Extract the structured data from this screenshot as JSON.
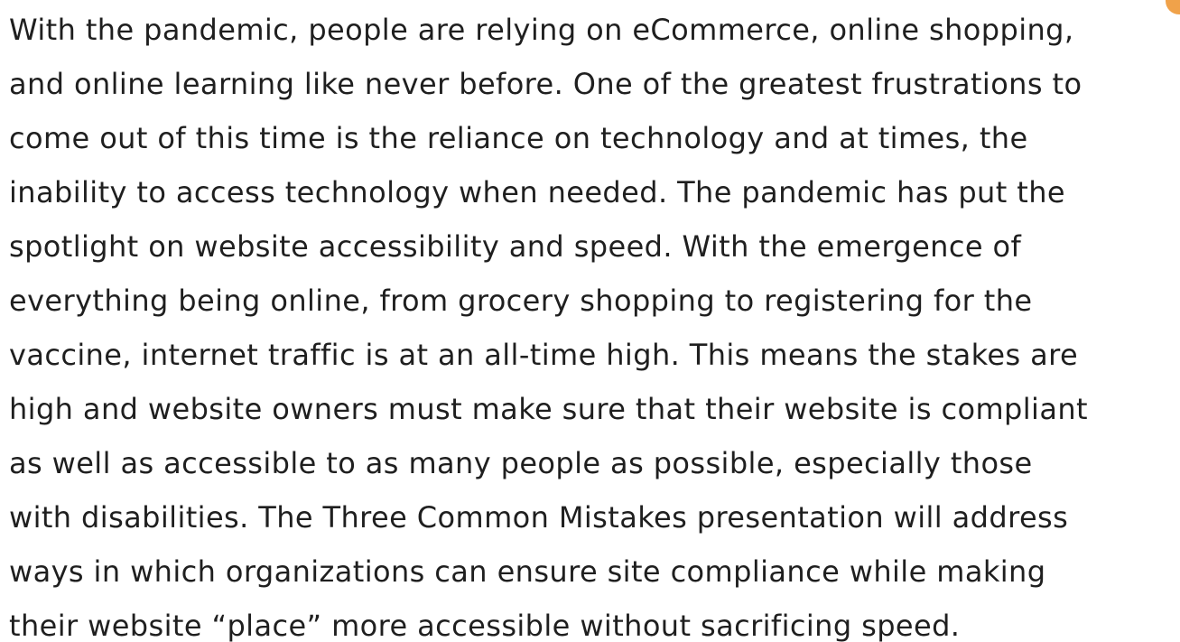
{
  "document": {
    "accent_color": "#f0a24a",
    "text_color": "#1f1f1f",
    "lines": [
      "With the pandemic, people are relying on eCommerce, online shopping,",
      "and online learning like never before. One of the greatest frustrations to",
      "come out of this time is the reliance on technology and at times, the",
      "inability to access technology when needed. The pandemic has put the",
      "spotlight on website accessibility and speed. With the emergence of",
      "everything being online, from grocery shopping to registering for the",
      "vaccine, internet traffic is at an all-time high.  This means the stakes are",
      "high and website owners must make sure that their website is compliant",
      "as well as accessible to as many people as possible, especially those",
      "with disabilities. The Three Common Mistakes presentation will address",
      "ways in which organizations can ensure site compliance while making",
      "their website “place” more accessible without sacrificing speed."
    ]
  }
}
